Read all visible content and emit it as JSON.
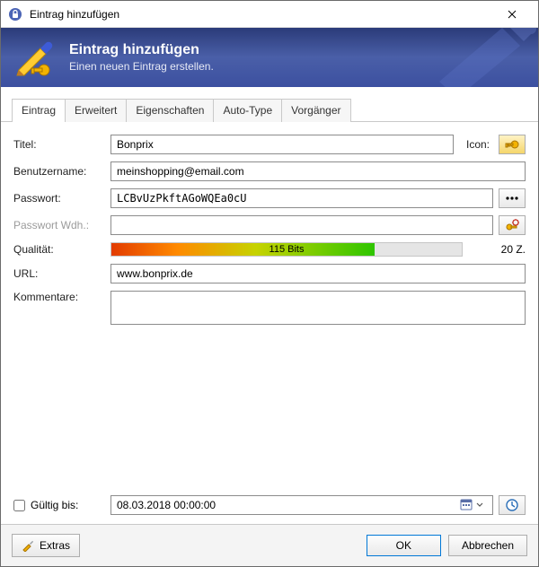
{
  "window": {
    "title": "Eintrag hinzufügen"
  },
  "banner": {
    "heading": "Eintrag hinzufügen",
    "sub": "Einen neuen Eintrag erstellen."
  },
  "tabs": {
    "entry": "Eintrag",
    "advanced": "Erweitert",
    "properties": "Eigenschaften",
    "autotype": "Auto-Type",
    "history": "Vorgänger"
  },
  "labels": {
    "title": "Titel:",
    "icon": "Icon:",
    "username": "Benutzername:",
    "password": "Passwort:",
    "password_repeat": "Passwort Wdh.:",
    "quality": "Qualität:",
    "url": "URL:",
    "comments": "Kommentare:",
    "expires": "Gültig bis:"
  },
  "values": {
    "title": "Bonprix",
    "username": "meinshopping@email.com",
    "password": "LCBvUzPkftAGoWQEa0cU",
    "password_repeat": "",
    "quality_bits": "115 Bits",
    "quality_chars": "20 Z.",
    "url": "www.bonprix.de",
    "comments": "",
    "expiry_date": "08.03.2018 00:00:00"
  },
  "buttons": {
    "extras": "Extras",
    "ok": "OK",
    "cancel": "Abbrechen"
  }
}
